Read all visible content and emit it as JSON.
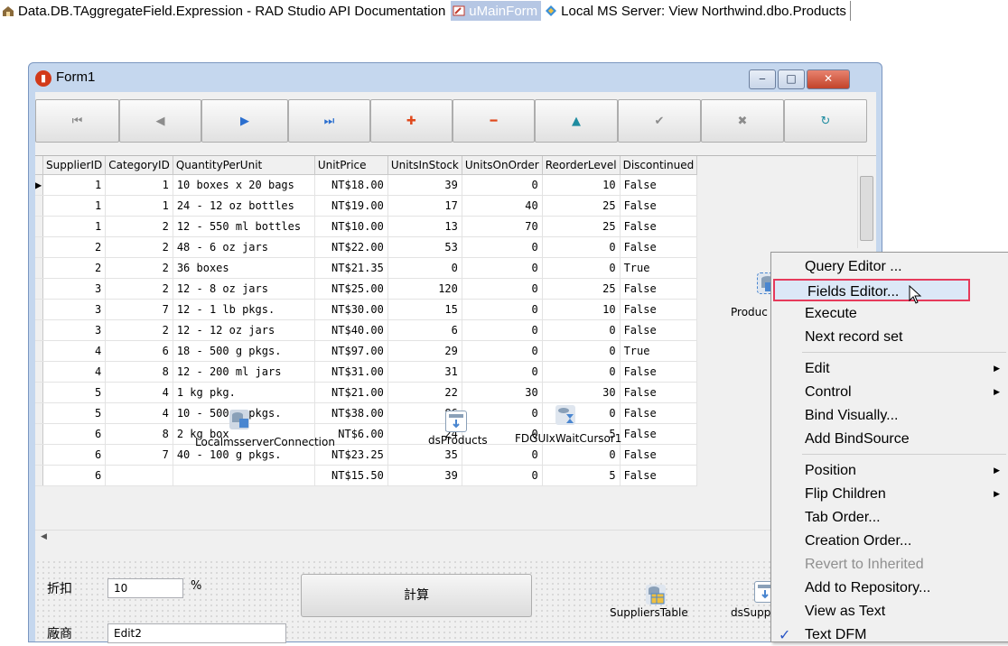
{
  "tabs": [
    {
      "label": "Data.DB.TAggregateField.Expression - RAD Studio API Documentation",
      "icon": "house-icon"
    },
    {
      "label": "uMainForm",
      "icon": "form-unit-icon"
    },
    {
      "label": "Local MS Server: View Northwind.dbo.Products",
      "icon": "database-view-icon"
    }
  ],
  "form": {
    "title": "Form1",
    "window_buttons": {
      "minimize": "‒",
      "maximize": "□",
      "close": "✕"
    }
  },
  "navigator": [
    {
      "name": "nav-first-button",
      "glyph": "⏮",
      "style": "grey"
    },
    {
      "name": "nav-prior-button",
      "glyph": "◀",
      "style": "grey"
    },
    {
      "name": "nav-next-button",
      "glyph": "▶",
      "style": "blue"
    },
    {
      "name": "nav-last-button",
      "glyph": "⏭",
      "style": "blue"
    },
    {
      "name": "nav-insert-button",
      "glyph": "✚",
      "style": "red"
    },
    {
      "name": "nav-delete-button",
      "glyph": "━",
      "style": "red"
    },
    {
      "name": "nav-edit-button",
      "glyph": "▲",
      "style": "teal"
    },
    {
      "name": "nav-post-button",
      "glyph": "✔",
      "style": "grey"
    },
    {
      "name": "nav-cancel-button",
      "glyph": "✖",
      "style": "grey"
    },
    {
      "name": "nav-refresh-button",
      "glyph": "↻",
      "style": "teal"
    }
  ],
  "grid": {
    "columns": [
      "SupplierID",
      "CategoryID",
      "QuantityPerUnit",
      "UnitPrice",
      "UnitsInStock",
      "UnitsOnOrder",
      "ReorderLevel",
      "Discontinued"
    ],
    "current_row_marker": "▶",
    "rows": [
      [
        "1",
        "1",
        "10 boxes x 20 bags",
        "NT$18.00",
        "39",
        "0",
        "10",
        "False"
      ],
      [
        "1",
        "1",
        "24 - 12 oz bottles",
        "NT$19.00",
        "17",
        "40",
        "25",
        "False"
      ],
      [
        "1",
        "2",
        "12 - 550 ml bottles",
        "NT$10.00",
        "13",
        "70",
        "25",
        "False"
      ],
      [
        "2",
        "2",
        "48 - 6 oz jars",
        "NT$22.00",
        "53",
        "0",
        "0",
        "False"
      ],
      [
        "2",
        "2",
        "36 boxes",
        "NT$21.35",
        "0",
        "0",
        "0",
        "True"
      ],
      [
        "3",
        "2",
        "12 - 8 oz jars",
        "NT$25.00",
        "120",
        "0",
        "25",
        "False"
      ],
      [
        "3",
        "7",
        "12 - 1 lb pkgs.",
        "NT$30.00",
        "15",
        "0",
        "10",
        "False"
      ],
      [
        "3",
        "2",
        "12 - 12 oz jars",
        "NT$40.00",
        "6",
        "0",
        "0",
        "False"
      ],
      [
        "4",
        "6",
        "18 - 500 g pkgs.",
        "NT$97.00",
        "29",
        "0",
        "0",
        "True"
      ],
      [
        "4",
        "8",
        "12 - 200 ml jars",
        "NT$31.00",
        "31",
        "0",
        "0",
        "False"
      ],
      [
        "5",
        "4",
        "1 kg pkg.",
        "NT$21.00",
        "22",
        "30",
        "30",
        "False"
      ],
      [
        "5",
        "4",
        "10 - 500 g pkgs.",
        "NT$38.00",
        "86",
        "0",
        "0",
        "False"
      ],
      [
        "6",
        "8",
        "2 kg box",
        "NT$6.00",
        "24",
        "0",
        "5",
        "False"
      ],
      [
        "6",
        "7",
        "40 - 100 g pkgs.",
        "NT$23.25",
        "35",
        "0",
        "0",
        "False"
      ],
      [
        "6",
        "",
        "",
        "NT$15.50",
        "39",
        "0",
        "5",
        "False"
      ]
    ]
  },
  "fields": {
    "discount_label": "折扣",
    "discount_value": "10",
    "percent_label": "%",
    "calc_button": "計算",
    "vendor_label": "廠商",
    "vendor_value": "Edit2"
  },
  "components": {
    "connection": "LocalmsserverConnection",
    "ds_products": "dsProducts",
    "wait_cursor": "FDGUIxWaitCursor1",
    "products_query": "Produc",
    "suppliers_table": "SuppliersTable",
    "ds_suppliers": "dsSupp"
  },
  "context_menu": {
    "items": [
      {
        "label": "Query Editor ...",
        "state": "normal"
      },
      {
        "label": "Fields Editor...",
        "state": "highlighted"
      },
      {
        "label": "Execute",
        "state": "normal"
      },
      {
        "label": "Next record set",
        "state": "normal"
      },
      {
        "label": "Edit",
        "state": "submenu"
      },
      {
        "label": "Control",
        "state": "submenu"
      },
      {
        "label": "Bind Visually...",
        "state": "normal"
      },
      {
        "label": "Add BindSource",
        "state": "normal"
      },
      {
        "label": "Position",
        "state": "submenu"
      },
      {
        "label": "Flip Children",
        "state": "submenu"
      },
      {
        "label": "Tab Order...",
        "state": "normal"
      },
      {
        "label": "Creation Order...",
        "state": "normal"
      },
      {
        "label": "Revert to Inherited",
        "state": "disabled"
      },
      {
        "label": "Add to Repository...",
        "state": "normal"
      },
      {
        "label": "View as Text",
        "state": "normal"
      },
      {
        "label": "Text DFM",
        "state": "checked"
      }
    ],
    "submenu_glyph": "▶",
    "check_glyph": "✓"
  },
  "colors": {
    "form_frame": "#c5d7ee",
    "menu_highlight_border": "#e63a5b",
    "active_tab": "#b6c7e4"
  }
}
